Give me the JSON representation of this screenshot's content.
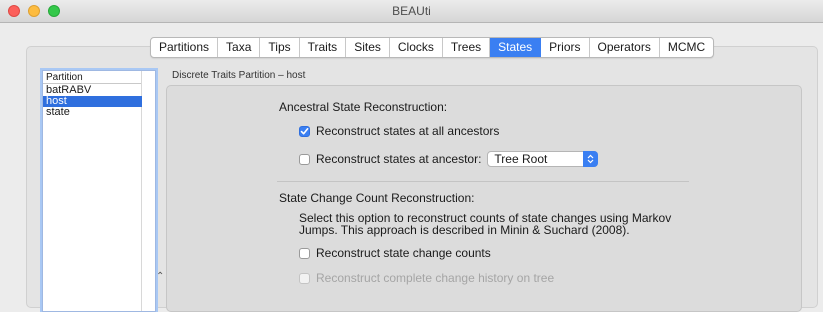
{
  "window": {
    "title": "BEAUti"
  },
  "tabs": [
    {
      "label": "Partitions",
      "active": false
    },
    {
      "label": "Taxa",
      "active": false
    },
    {
      "label": "Tips",
      "active": false
    },
    {
      "label": "Traits",
      "active": false
    },
    {
      "label": "Sites",
      "active": false
    },
    {
      "label": "Clocks",
      "active": false
    },
    {
      "label": "Trees",
      "active": false
    },
    {
      "label": "States",
      "active": true
    },
    {
      "label": "Priors",
      "active": false
    },
    {
      "label": "Operators",
      "active": false
    },
    {
      "label": "MCMC",
      "active": false
    }
  ],
  "partition_list": {
    "header": "Partition",
    "rows": [
      {
        "label": "batRABV",
        "selected": false
      },
      {
        "label": "host",
        "selected": true
      },
      {
        "label": "state",
        "selected": false
      }
    ]
  },
  "detail": {
    "partition_label": "Discrete Traits Partition – host",
    "ancestral": {
      "title": "Ancestral State Reconstruction:",
      "all_ancestors": {
        "label": "Reconstruct states at all ancestors",
        "checked": true
      },
      "at_ancestor": {
        "label": "Reconstruct states at ancestor:",
        "checked": false,
        "selected_value": "Tree Root"
      }
    },
    "state_change": {
      "title": "State Change Count Reconstruction:",
      "description_line1": "Select this option to reconstruct counts of state changes using Markov",
      "description_line2": "Jumps. This approach is described in Minin & Suchard (2008).",
      "change_counts": {
        "label": "Reconstruct state change counts",
        "checked": false
      },
      "complete_history": {
        "label": "Reconstruct complete change history on tree",
        "checked": false,
        "disabled": true
      }
    }
  },
  "colors": {
    "accent": "#3a7ff2",
    "selection": "#2f6fde"
  }
}
